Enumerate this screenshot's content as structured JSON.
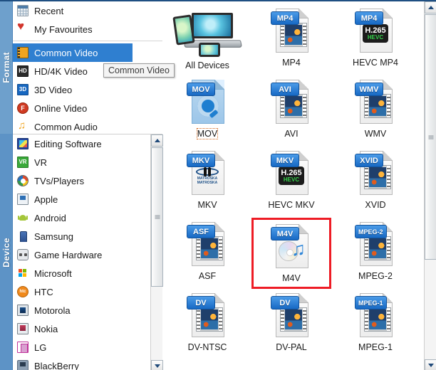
{
  "window": {
    "accent_blue": "#2f7fd0",
    "highlight_red": "#ee1c25",
    "rail_blue": "#5a93c9"
  },
  "rail": {
    "tabs": [
      {
        "label": "Format",
        "name": "rail-tab-format"
      },
      {
        "label": "Device",
        "name": "rail-tab-device"
      }
    ]
  },
  "sidebar": {
    "format_groups": [
      {
        "label": "Recent",
        "icon": "calendar-icon",
        "selected": false
      },
      {
        "label": "My Favourites",
        "icon": "heart-icon",
        "selected": false
      },
      {
        "label": "Common Video",
        "icon": "film-icon",
        "selected": true
      },
      {
        "label": "HD/4K Video",
        "icon": "hd-icon",
        "selected": false
      },
      {
        "label": "3D Video",
        "icon": "3d-icon",
        "selected": false
      },
      {
        "label": "Online Video",
        "icon": "online-icon",
        "selected": false
      },
      {
        "label": "Common Audio",
        "icon": "music-note-icon",
        "selected": false
      }
    ],
    "device_groups": [
      {
        "label": "Editing Software",
        "icon": "editing-software-icon"
      },
      {
        "label": "VR",
        "icon": "vr-icon"
      },
      {
        "label": "TVs/Players",
        "icon": "tv-player-icon"
      },
      {
        "label": "Apple",
        "icon": "apple-device-icon"
      },
      {
        "label": "Android",
        "icon": "android-icon"
      },
      {
        "label": "Samsung",
        "icon": "samsung-icon"
      },
      {
        "label": "Game Hardware",
        "icon": "gamepad-icon"
      },
      {
        "label": "Microsoft",
        "icon": "microsoft-icon"
      },
      {
        "label": "HTC",
        "icon": "htc-icon"
      },
      {
        "label": "Motorola",
        "icon": "motorola-icon"
      },
      {
        "label": "Nokia",
        "icon": "nokia-icon"
      },
      {
        "label": "LG",
        "icon": "lg-icon"
      },
      {
        "label": "BlackBerry",
        "icon": "blackberry-icon"
      }
    ]
  },
  "tooltip": {
    "text": "Common Video"
  },
  "formats": {
    "rows": [
      [
        {
          "label": "All Devices",
          "tag": "",
          "icon": "all-devices-icon",
          "selected": false,
          "focused": false
        },
        {
          "label": "MP4",
          "tag": "MP4",
          "icon": "mp4-file-icon",
          "selected": false,
          "focused": false
        },
        {
          "label": "HEVC MP4",
          "tag": "MP4",
          "icon": "hevc-mp4-file-icon",
          "selected": false,
          "focused": false
        }
      ],
      [
        {
          "label": "MOV",
          "tag": "MOV",
          "icon": "mov-file-icon",
          "selected": false,
          "focused": true
        },
        {
          "label": "AVI",
          "tag": "AVI",
          "icon": "avi-file-icon",
          "selected": false,
          "focused": false
        },
        {
          "label": "WMV",
          "tag": "WMV",
          "icon": "wmv-file-icon",
          "selected": false,
          "focused": false
        }
      ],
      [
        {
          "label": "MKV",
          "tag": "MKV",
          "icon": "mkv-file-icon",
          "selected": false,
          "focused": false
        },
        {
          "label": "HEVC MKV",
          "tag": "MKV",
          "icon": "hevc-mkv-file-icon",
          "selected": false,
          "focused": false
        },
        {
          "label": "XVID",
          "tag": "XVID",
          "icon": "xvid-file-icon",
          "selected": false,
          "focused": false
        }
      ],
      [
        {
          "label": "ASF",
          "tag": "ASF",
          "icon": "asf-file-icon",
          "selected": false,
          "focused": false
        },
        {
          "label": "M4V",
          "tag": "M4V",
          "icon": "m4v-file-icon",
          "selected": true,
          "focused": false
        },
        {
          "label": "MPEG-2",
          "tag": "MPEG-2",
          "icon": "mpeg2-file-icon",
          "selected": false,
          "focused": false
        }
      ],
      [
        {
          "label": "DV-NTSC",
          "tag": "DV",
          "icon": "dv-ntsc-file-icon",
          "selected": false,
          "focused": false
        },
        {
          "label": "DV-PAL",
          "tag": "DV",
          "icon": "dv-pal-file-icon",
          "selected": false,
          "focused": false
        },
        {
          "label": "MPEG-1",
          "tag": "MPEG-1",
          "icon": "mpeg1-file-icon",
          "selected": false,
          "focused": false
        }
      ]
    ]
  },
  "scrollbars": {
    "sidebar": {
      "up_arrow": "scroll-up-arrow",
      "down_arrow": "scroll-down-arrow"
    },
    "main": {
      "up_arrow": "scroll-up-arrow",
      "down_arrow": "scroll-down-arrow"
    }
  }
}
